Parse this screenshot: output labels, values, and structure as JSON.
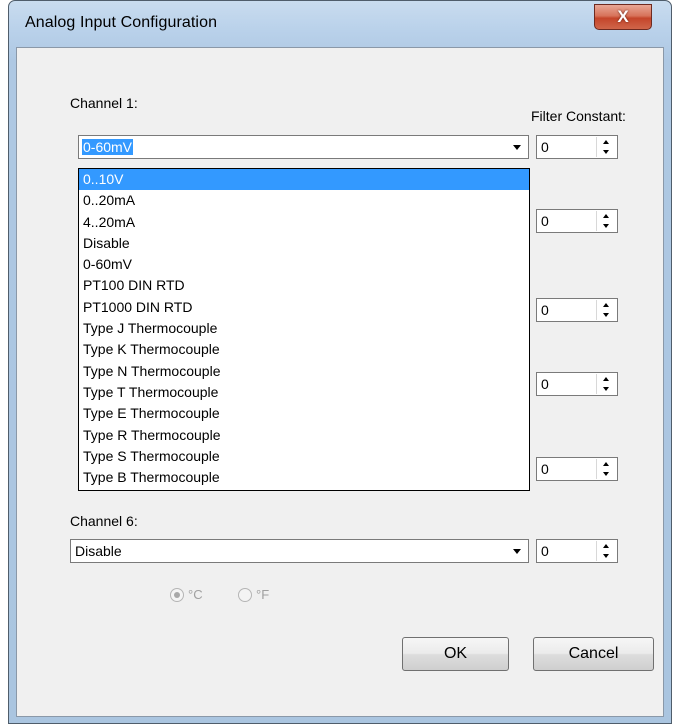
{
  "window": {
    "title": "Analog Input Configuration",
    "close_glyph": "X"
  },
  "labels": {
    "channel1": "Channel 1:",
    "channel6": "Channel 6:",
    "filter_constant": "Filter Constant:"
  },
  "channel1": {
    "value": "0-60mV"
  },
  "channel6": {
    "value": "Disable"
  },
  "filters": [
    "0",
    "0",
    "0",
    "0",
    "0",
    "0"
  ],
  "dropdown": {
    "options": [
      "0..10V",
      "0..20mA",
      "4..20mA",
      "Disable",
      "0-60mV",
      "PT100 DIN RTD",
      "PT1000 DIN RTD",
      "Type J Thermocouple",
      "Type K Thermocouple",
      "Type N Thermocouple",
      "Type T Thermocouple",
      "Type E Thermocouple",
      "Type R Thermocouple",
      "Type S Thermocouple",
      "Type B Thermocouple"
    ],
    "highlighted": "0..10V"
  },
  "units": {
    "celsius": "°C",
    "fahrenheit": "°F",
    "selected": "°C"
  },
  "buttons": {
    "ok": "OK",
    "cancel": "Cancel"
  },
  "colors": {
    "selection": "#3399ff",
    "close_button": "#c4452a"
  }
}
